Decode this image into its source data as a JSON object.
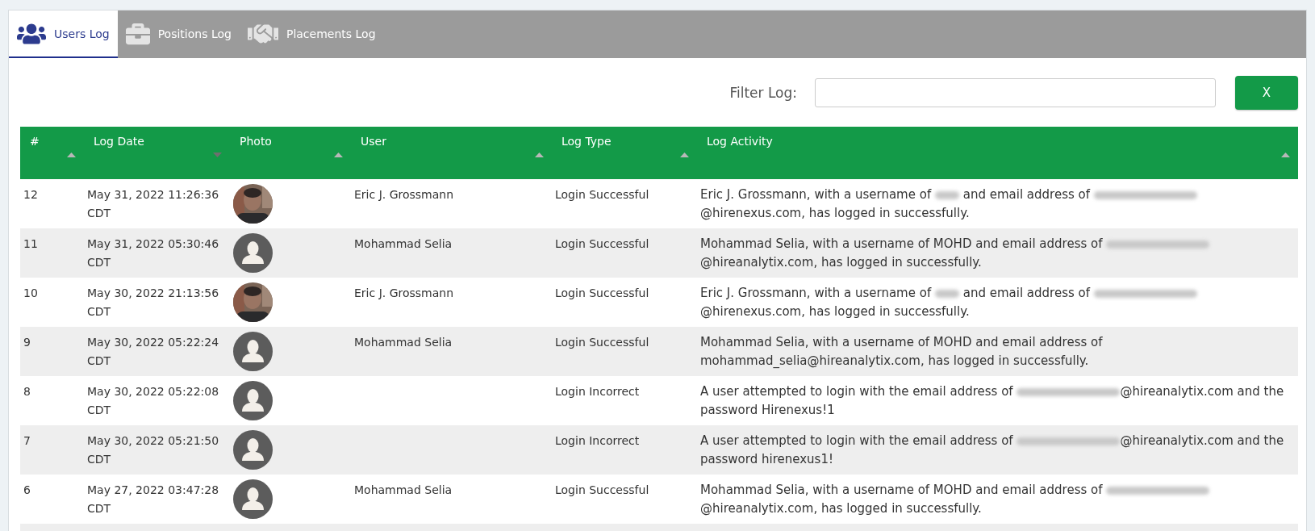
{
  "tabs": [
    {
      "label": "Users Log",
      "selected": true
    },
    {
      "label": "Positions Log",
      "selected": false
    },
    {
      "label": "Placements Log",
      "selected": false
    }
  ],
  "filter": {
    "label": "Filter Log:",
    "clear_button": "X"
  },
  "table": {
    "columns": [
      {
        "label": "#",
        "sorted": false
      },
      {
        "label": "Log Date",
        "sorted": true
      },
      {
        "label": "Photo",
        "sorted": false
      },
      {
        "label": "User",
        "sorted": false
      },
      {
        "label": "Log Type",
        "sorted": false
      },
      {
        "label": "Log Activity",
        "sorted": false
      }
    ],
    "rows": [
      {
        "number": "12",
        "date": "May 31, 2022 11:26:36 CDT",
        "photo": {
          "kind": "picture"
        },
        "user": "Eric J. Grossmann",
        "type": "Login Successful",
        "activity": [
          {
            "kind": "text",
            "text": "Eric J. Grossmann, with a username of "
          },
          {
            "kind": "redacted"
          },
          {
            "kind": "text",
            "text": " and email address of "
          },
          {
            "kind": "redactedlong"
          },
          {
            "kind": "text",
            "text": "@hirenexus.com, has logged in successfully."
          }
        ]
      },
      {
        "number": "11",
        "date": "May 31, 2022 05:30:46 CDT",
        "photo": {
          "kind": "avatar"
        },
        "user": "Mohammad Selia",
        "type": "Login Successful",
        "activity": [
          {
            "kind": "text",
            "text": "Mohammad Selia, with a username of MOHD and email address of "
          },
          {
            "kind": "redactedlong"
          },
          {
            "kind": "text",
            "text": "@hireanalytix.com, has logged in successfully."
          }
        ]
      },
      {
        "number": "10",
        "date": "May 30, 2022 21:13:56 CDT",
        "photo": {
          "kind": "picture"
        },
        "user": "Eric J. Grossmann",
        "type": "Login Successful",
        "activity": [
          {
            "kind": "text",
            "text": "Eric J. Grossmann, with a username of "
          },
          {
            "kind": "redacted"
          },
          {
            "kind": "text",
            "text": " and email address of "
          },
          {
            "kind": "redactedlong"
          },
          {
            "kind": "text",
            "text": "@hirenexus.com, has logged in successfully."
          }
        ]
      },
      {
        "number": "9",
        "date": "May 30, 2022 05:22:24 CDT",
        "photo": {
          "kind": "avatar"
        },
        "user": "Mohammad Selia",
        "type": "Login Successful",
        "activity": [
          {
            "kind": "text",
            "text": "Mohammad Selia, with a username of MOHD and email address of mohammad_selia@hireanalytix.com, has logged in successfully."
          }
        ]
      },
      {
        "number": "8",
        "date": "May 30, 2022 05:22:08 CDT",
        "photo": {
          "kind": "avatar"
        },
        "user": "",
        "type": "Login Incorrect",
        "activity": [
          {
            "kind": "text",
            "text": "A user attempted to login with the email address of "
          },
          {
            "kind": "redactedlong"
          },
          {
            "kind": "text",
            "text": "@hireanalytix.com and the password Hirenexus!1"
          }
        ]
      },
      {
        "number": "7",
        "date": "May 30, 2022 05:21:50 CDT",
        "photo": {
          "kind": "avatar"
        },
        "user": "",
        "type": "Login Incorrect",
        "activity": [
          {
            "kind": "text",
            "text": "A user attempted to login with the email address of "
          },
          {
            "kind": "redactedlong"
          },
          {
            "kind": "text",
            "text": "@hireanalytix.com and the password hirenexus1!"
          }
        ]
      },
      {
        "number": "6",
        "date": "May 27, 2022 03:47:28 CDT",
        "photo": {
          "kind": "avatar"
        },
        "user": "Mohammad Selia",
        "type": "Login Successful",
        "activity": [
          {
            "kind": "text",
            "text": "Mohammad Selia, with a username of MOHD and email address of "
          },
          {
            "kind": "redactedlong"
          },
          {
            "kind": "text",
            "text": "@hireanalytix.com, has logged in successfully."
          }
        ]
      }
    ]
  }
}
